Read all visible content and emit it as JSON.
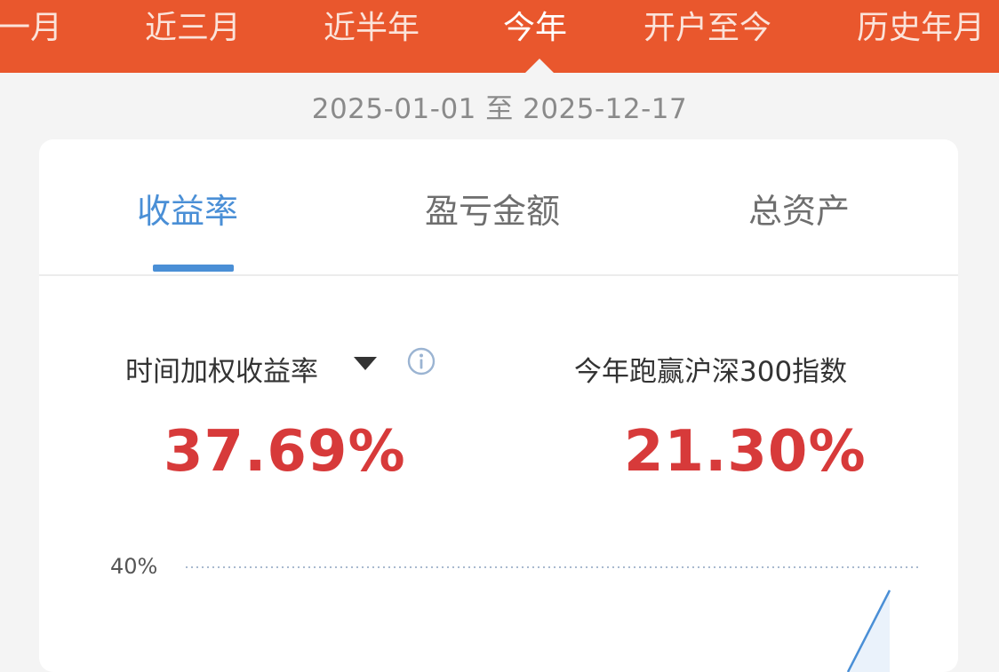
{
  "period_tabs": [
    {
      "label": "近一月"
    },
    {
      "label": "近三月"
    },
    {
      "label": "近半年"
    },
    {
      "label": "今年",
      "active": true
    },
    {
      "label": "开户至今"
    },
    {
      "label": "历史年月"
    }
  ],
  "date_range": "2025-01-01 至 2025-12-17",
  "metric_tabs": [
    {
      "label": "收益率",
      "active": true
    },
    {
      "label": "盈亏金额"
    },
    {
      "label": "总资产"
    }
  ],
  "stats": {
    "left": {
      "label": "时间加权收益率",
      "value": "37.69%"
    },
    "right": {
      "label": "今年跑赢沪深300指数",
      "value": "21.30%"
    }
  },
  "chart_data": {
    "type": "line",
    "y_tick_labels": [
      "40%"
    ],
    "grid": "dotted"
  },
  "colors": {
    "brand": "#e9572d",
    "accent": "#4a8fd6",
    "gain": "#d73a3a"
  }
}
